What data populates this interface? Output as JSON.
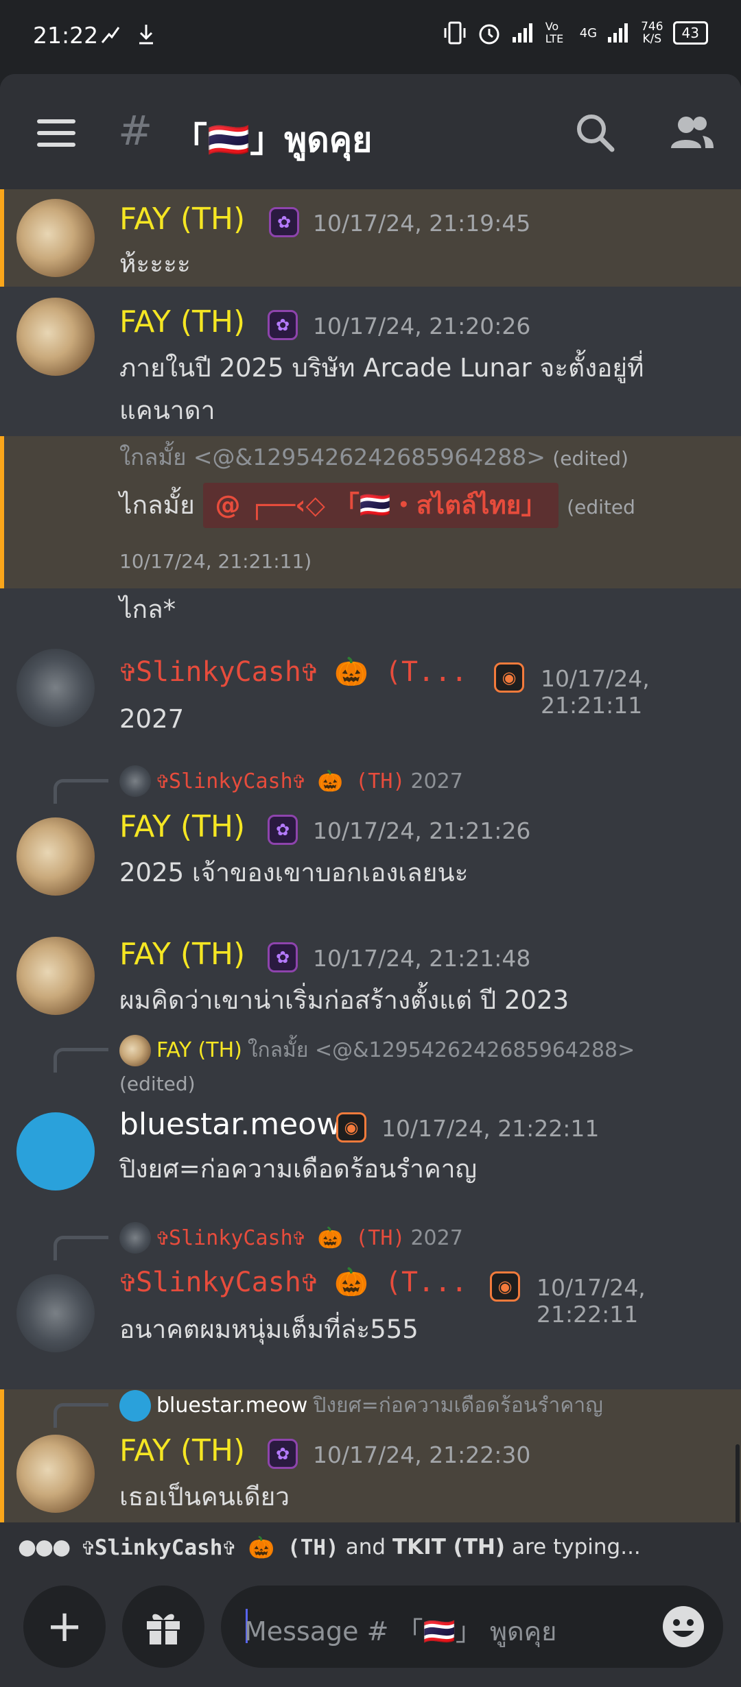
{
  "status_bar": {
    "time": "21:22",
    "network_speed_value": "746",
    "network_speed_unit": "K/S",
    "battery": "43",
    "volte_label": "Vo LTE",
    "network_label": "4G"
  },
  "header": {
    "channel_name": "「🇹🇭」พูดคุย",
    "hash": "#"
  },
  "messages": [
    {
      "author": "FAY (TH)",
      "timestamp": "10/17/24, 21:19:45",
      "text": "ห้ะะะะ"
    },
    {
      "author": "FAY (TH)",
      "timestamp": "10/17/24, 21:20:26",
      "text_line1": "ภายในปี 2025 บริษัท Arcade Lunar จะตั้งอยู่ที่",
      "text_line2": "แคนาดา"
    },
    {
      "edited_prev": "ใกลมั้ย <@&1295426242685964288>",
      "edited_tag": "(edited)",
      "text_prefix": "ไกลมั้ย",
      "mention": "@ ┌──‹◇ 「🇹🇭・สไตล์ไทย」",
      "edited_tag2": "(edited",
      "edited_time": "10/17/24, 21:21:11)"
    },
    {
      "text": "ไกล*"
    },
    {
      "author": "✞SlinkyCash✞ 🎃 (T...",
      "timestamp": "10/17/24, 21:21:11",
      "text": "2027"
    },
    {
      "reply_author": "✞SlinkyCash✞ 🎃 (TH)",
      "reply_text": "2027",
      "author": "FAY (TH)",
      "timestamp": "10/17/24, 21:21:26",
      "text": "2025 เจ้าของเขาบอกเองเลยนะ"
    },
    {
      "author": "FAY (TH)",
      "timestamp": "10/17/24, 21:21:48",
      "text": "ผมคิดว่าเขาน่าเริ่มก่อสร้างตั้งแต่ ปี 2023"
    },
    {
      "reply_author": "FAY (TH)",
      "reply_text": "ใกลมั้ย <@&1295426242685964288>",
      "reply_edited": "(edited)",
      "author": "bluestar.meow",
      "timestamp": "10/17/24, 21:22:11",
      "text": "ปิงยศ=ก่อความเดือดร้อนรำคาญ"
    },
    {
      "reply_author": "✞SlinkyCash✞ 🎃 (TH)",
      "reply_text": "2027",
      "author": "✞SlinkyCash✞ 🎃 (T...",
      "timestamp": "10/17/24, 21:22:11",
      "text": "อนาคตผมหนุ่มเต็มที่ล่ะ555"
    },
    {
      "reply_author": "bluestar.meow",
      "reply_text": "ปิงยศ=ก่อความเดือดร้อนรำคาญ",
      "author": "FAY (TH)",
      "timestamp": "10/17/24, 21:22:30",
      "text": "เธอเป็นคนเดียว"
    }
  ],
  "typing": {
    "user1": "✞SlinkyCash✞ 🎃 (TH)",
    "and": "and",
    "user2": "TKIT (TH)",
    "suffix": "are typing..."
  },
  "composer": {
    "placeholder": "Message # 「🇹🇭」 พูดคุย",
    "add_label": "+"
  },
  "colors": {
    "background": "#36393f",
    "highlight": "#49443c",
    "highlight_border": "#faa61a",
    "fay": "#f5e623",
    "slinky": "#e74c3c"
  }
}
